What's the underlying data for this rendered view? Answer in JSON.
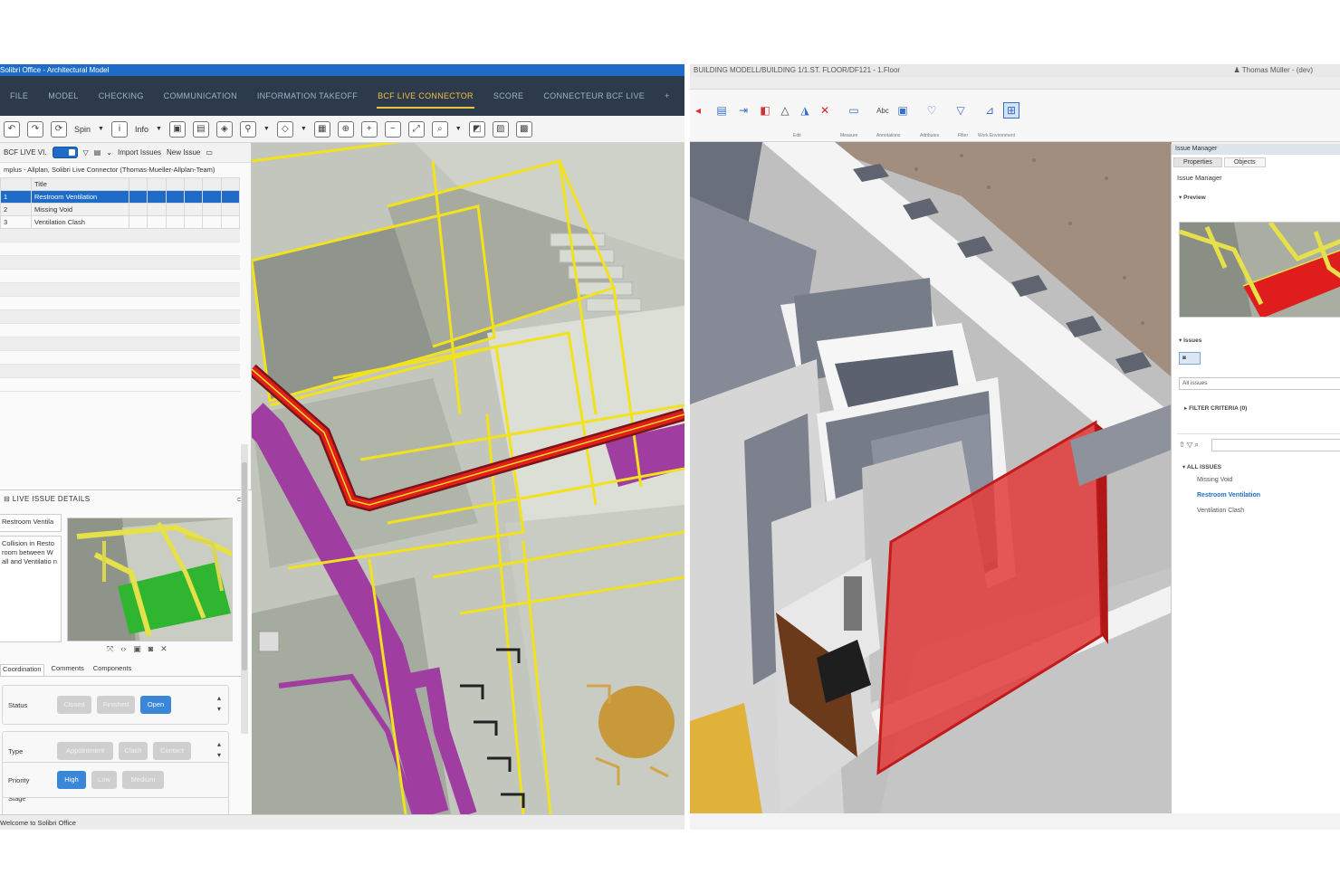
{
  "left_window": {
    "title": "Solibri Office - Architectural Model",
    "menu": [
      "FILE",
      "MODEL",
      "CHECKING",
      "COMMUNICATION",
      "INFORMATION TAKEOFF",
      "BCF LIVE CONNECTOR",
      "SCORE",
      "CONNECTEUR BCF LIVE",
      "+"
    ],
    "active_menu": "BCF LIVE CONNECTOR",
    "toolbar": {
      "spin_label": "Spin",
      "info_label": "Info"
    },
    "panel": {
      "header_label": "BCF LIVE VI.",
      "import_label": "Import Issues",
      "new_issue_label": "New Issue",
      "project_line": "mplus - Allplan, Solibri Live Connector (Thomas-Mueller-Allplan-Team)",
      "table_header": "Title",
      "issues": [
        {
          "num": "1",
          "title": "Restroom Ventilation"
        },
        {
          "num": "2",
          "title": "Missing Void"
        },
        {
          "num": "3",
          "title": "Ventilation Clash"
        }
      ]
    },
    "details": {
      "title": "LIVE ISSUE DETAILS",
      "issue_name": "Restroom Ventila",
      "description": "Collision in Resto room between W all and Ventilatio n",
      "tabs": [
        "Coordination",
        "Comments",
        "Components"
      ],
      "status_label": "Status",
      "status_options": [
        "Closed",
        "Finished",
        "Open"
      ],
      "type_label": "Type",
      "type_options": [
        "Appointment",
        "Clash",
        "Contact"
      ],
      "stage_label": "Stage",
      "priority_label": "Priority",
      "priority_options": [
        "High",
        "Low",
        "Medium"
      ]
    },
    "status_bar": "Welcome to Solibri Office"
  },
  "right_window": {
    "title": "BUILDING MODELL/BUILDING 1/1.ST. FLOOR/DF121 - 1.Floor",
    "user": "Thomas Müller - (dev)",
    "ribbon_groups": [
      "Edit",
      "Measure",
      "Annotations",
      "Attributes",
      "Filter",
      "Work Environment"
    ],
    "issue_manager": {
      "title": "Issue Manager",
      "tabs": [
        "Properties",
        "Objects"
      ],
      "heading": "Issue Manager",
      "preview_label": "Preview",
      "issues_label": "Issues",
      "filter_value": "All issues",
      "filter_criteria": "FILTER CRITERIA (0)",
      "tree_root": "ALL ISSUES",
      "tree_items": [
        "Missing Void",
        "Restroom Ventilation",
        "Ventilation Clash"
      ]
    }
  },
  "colors": {
    "accent": "#1e6cc8",
    "menu_bg": "#2d3a4c",
    "active_tab": "#f0c040",
    "pipe_yellow": "#f2e21c",
    "clash_red": "#e02020",
    "duct_purple": "#a040a0"
  }
}
